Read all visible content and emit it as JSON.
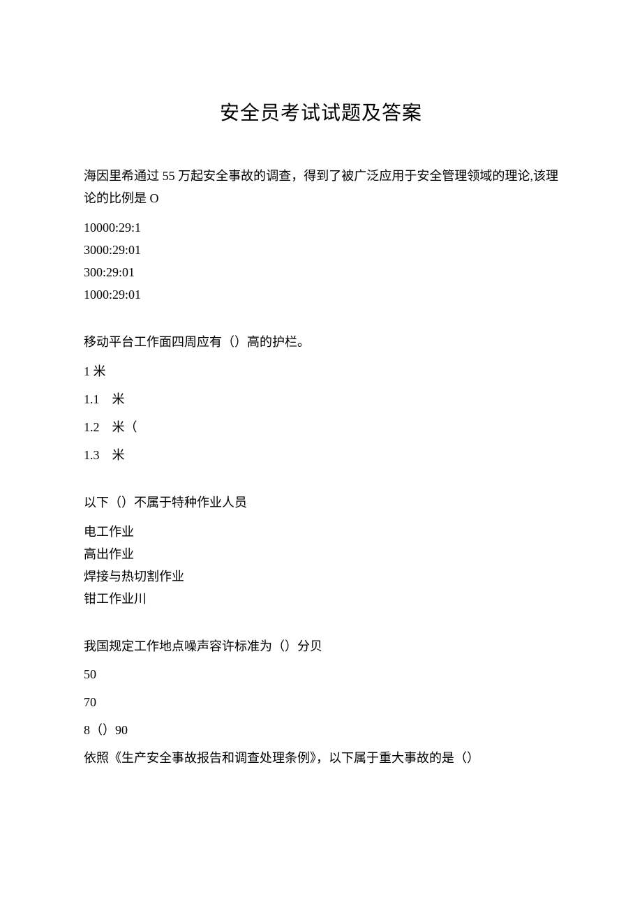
{
  "title": "安全员考试试题及答案",
  "q1": {
    "stem": "海因里希通过 55 万起安全事故的调查，得到了被广泛应用于安全管理领域的理论,该理论的比例是 O",
    "opts": [
      "10000:29:1",
      "3000:29:01",
      "300:29:01",
      "1000:29:01"
    ]
  },
  "q2": {
    "stem": "移动平台工作面四周应有（）高的护栏。",
    "opts": [
      "1 米",
      "1.1　米",
      "1.2　米（",
      "1.3　米"
    ]
  },
  "q3": {
    "stem": "以下（）不属于特种作业人员",
    "opts": [
      "电工作业",
      "高出作业",
      "焊接与热切割作业",
      "钳工作业川"
    ]
  },
  "q4": {
    "stem": "我国规定工作地点噪声容许标准为（）分贝",
    "opt_a": "50",
    "opt_b": "70",
    "opt_cd": "8（）90"
  },
  "q5": {
    "stem": "依照《生产安全事故报告和调查处理条例》，以下属于重大事故的是（）"
  }
}
